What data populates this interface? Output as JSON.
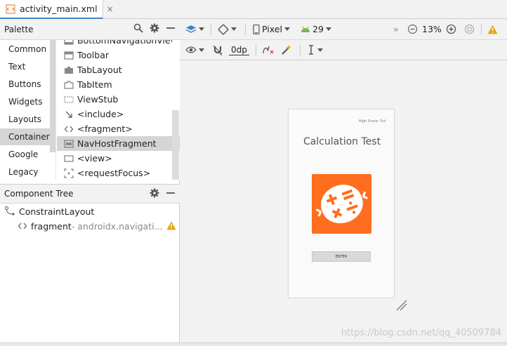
{
  "tab": {
    "file_name": "activity_main.xml",
    "close": "×"
  },
  "palette": {
    "title": "Palette",
    "categories": [
      "Common",
      "Text",
      "Buttons",
      "Widgets",
      "Layouts",
      "Container",
      "Google",
      "Legacy"
    ],
    "selected_category": "Container",
    "items": [
      {
        "label": "BottomNavigationView",
        "icon": "bottom-navigation-icon"
      },
      {
        "label": "Toolbar",
        "icon": "toolbar-icon"
      },
      {
        "label": "TabLayout",
        "icon": "tablayout-icon"
      },
      {
        "label": "TabItem",
        "icon": "tabitem-icon"
      },
      {
        "label": "ViewStub",
        "icon": "viewstub-icon"
      },
      {
        "label": "<include>",
        "icon": "include-icon"
      },
      {
        "label": "<fragment>",
        "icon": "fragment-icon"
      },
      {
        "label": "NavHostFragment",
        "icon": "navhostfragment-icon"
      },
      {
        "label": "<view>",
        "icon": "view-icon"
      },
      {
        "label": "<requestFocus>",
        "icon": "requestfocus-icon"
      }
    ],
    "selected_item": "NavHostFragment"
  },
  "component_tree": {
    "title": "Component Tree",
    "root": "ConstraintLayout",
    "child_name": "fragment",
    "child_detail": "- androidx.navigati..."
  },
  "toolbar": {
    "device": "Pixel",
    "api": "29",
    "zoom": "13%",
    "margin": "0dp",
    "overflow": "»"
  },
  "preview": {
    "high_score": "High Score: %d",
    "title": "Calculation Test",
    "enter_button": "ENTER"
  },
  "watermark": "https://blog.csdn.net/qq_40509784",
  "colors": {
    "accent_blue": "#4083c9",
    "logo_orange": "#ff6d1f",
    "warning_yellow": "#e8a400",
    "android_green": "#78b84a"
  }
}
